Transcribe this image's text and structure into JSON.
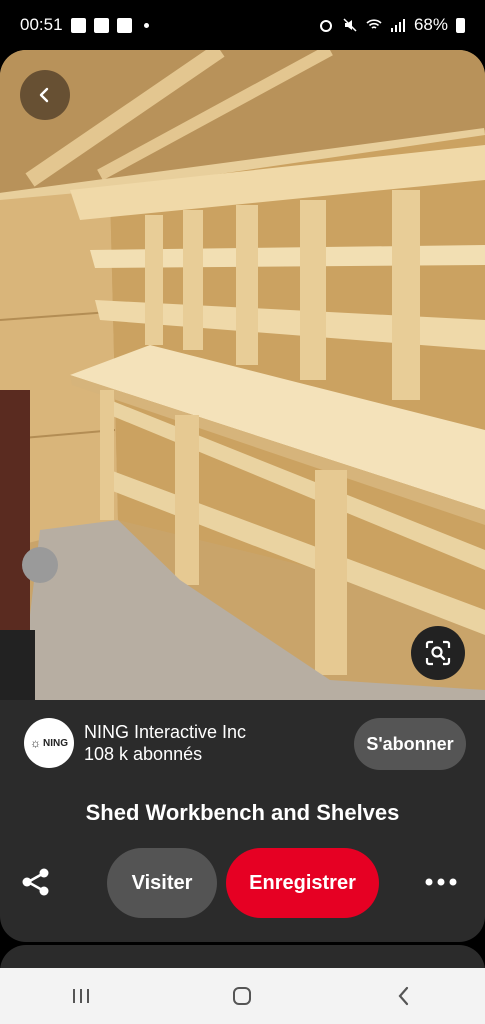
{
  "status_bar": {
    "time": "00:51",
    "battery": "68%"
  },
  "creator": {
    "name": "NING Interactive Inc",
    "subscribers": "108 k abonnés",
    "avatar_text": "NING"
  },
  "follow_button": "S'abonner",
  "pin_title": "Shed Workbench and Shelves",
  "buttons": {
    "visit": "Visiter",
    "save": "Enregistrer"
  },
  "colors": {
    "save_red": "#e60023",
    "panel_bg": "#2b2b2b",
    "button_gray": "#545454"
  }
}
